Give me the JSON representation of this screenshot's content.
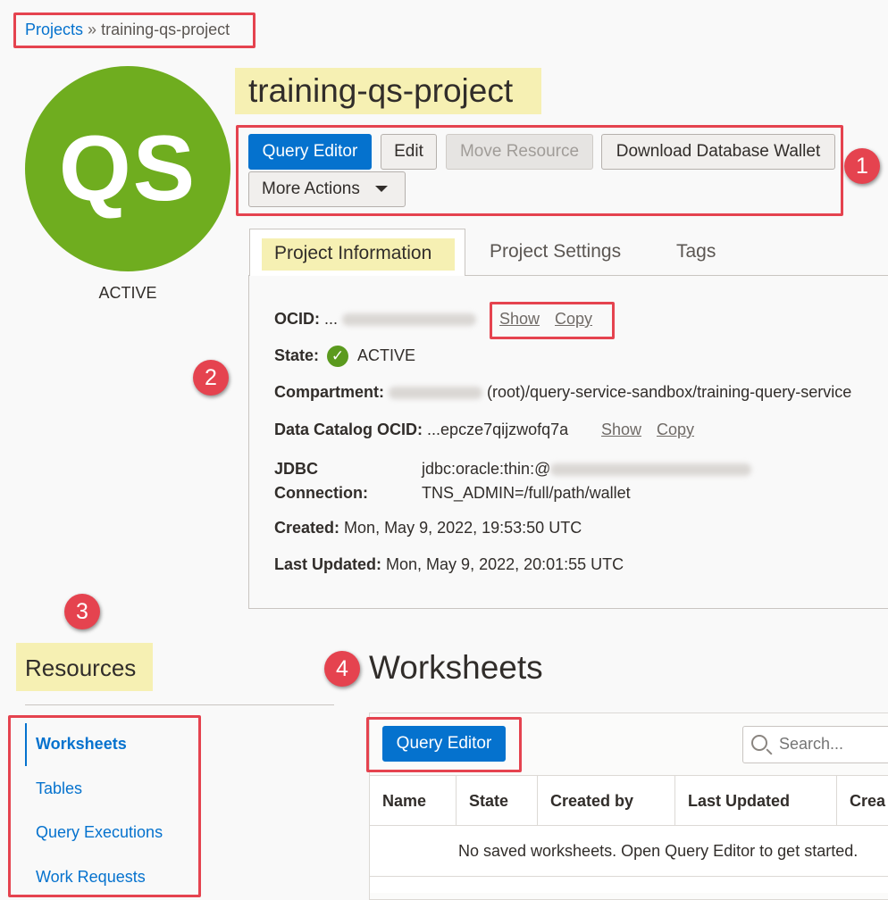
{
  "breadcrumb": {
    "root": "Projects",
    "separator": "»",
    "current": "training-qs-project"
  },
  "project": {
    "avatar_initials": "QS",
    "avatar_color": "#6fad1f",
    "status": "ACTIVE",
    "title": "training-qs-project"
  },
  "actions": {
    "query_editor": "Query Editor",
    "edit": "Edit",
    "move_resource": "Move Resource",
    "download_wallet": "Download Database Wallet",
    "more_actions": "More Actions"
  },
  "tabs": [
    "Project Information",
    "Project Settings",
    "Tags"
  ],
  "info": {
    "ocid_label": "OCID:",
    "ocid_prefix": "...",
    "show": "Show",
    "copy": "Copy",
    "state_label": "State:",
    "state_value": "ACTIVE",
    "compartment_label": "Compartment:",
    "compartment_value": "(root)/query-service-sandbox/training-query-service",
    "catalog_label": "Data Catalog OCID:",
    "catalog_value": "...epcze7qijzwofq7a",
    "jdbc_label_1": "JDBC",
    "jdbc_label_2": "Connection:",
    "jdbc_value_1": "jdbc:oracle:thin:@",
    "jdbc_value_2": "TNS_ADMIN=/full/path/wallet",
    "created_label": "Created:",
    "created_value": "Mon, May 9, 2022, 19:53:50 UTC",
    "updated_label": "Last Updated:",
    "updated_value": "Mon, May 9, 2022, 20:01:55 UTC"
  },
  "resources": {
    "title": "Resources",
    "items": [
      "Worksheets",
      "Tables",
      "Query Executions",
      "Work Requests"
    ]
  },
  "worksheets": {
    "title": "Worksheets",
    "query_editor": "Query Editor",
    "search_placeholder": "Search...",
    "columns": [
      "Name",
      "State",
      "Created by",
      "Last Updated",
      "Crea"
    ],
    "empty_message": "No saved worksheets. Open Query Editor to get started."
  },
  "badges": [
    "1",
    "2",
    "3",
    "4"
  ],
  "colors": {
    "accent": "#0572ce",
    "annotation": "#e5434f",
    "highlight": "#f6f0b3",
    "success": "#5b9a1e"
  }
}
